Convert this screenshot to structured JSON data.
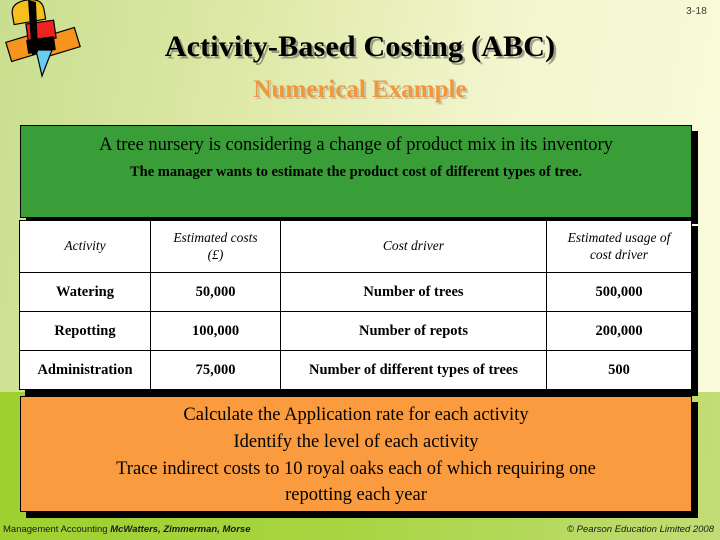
{
  "slide": {
    "number": "3-18",
    "title": "Activity-Based Costing (ABC)",
    "subtitle": "Numerical Example"
  },
  "logo": {
    "name": "abstract-geometric-logo"
  },
  "scenario": {
    "line1": "A tree nursery is considering a change of product mix in its inventory",
    "line2": "The manager wants to estimate the product cost of different types of tree."
  },
  "table": {
    "headers": [
      "Activity",
      "Estimated costs (£)",
      "Cost driver",
      "Estimated usage of cost driver"
    ],
    "header_lines": {
      "c1_l1": "Estimated costs",
      "c1_l2": "(£)",
      "c3_l1": "Estimated usage of",
      "c3_l2": "cost driver"
    },
    "rows": [
      {
        "activity": "Watering",
        "estimated_costs": "50,000",
        "cost_driver": "Number of trees",
        "estimated_usage": "500,000"
      },
      {
        "activity": "Repotting",
        "estimated_costs": "100,000",
        "cost_driver": "Number of repots",
        "estimated_usage": "200,000"
      },
      {
        "activity": "Administration",
        "estimated_costs": "75,000",
        "cost_driver": "Number of different types of trees",
        "estimated_usage": "500"
      }
    ]
  },
  "tasks": {
    "line1": "Calculate the Application rate for each activity",
    "line2": "Identify the level of each activity",
    "line3": "Trace indirect costs to 10 royal oaks each of which requiring one",
    "line4": "repotting each year"
  },
  "footer": {
    "book": "Management Accounting",
    "authors": "McWatters, Zimmerman, Morse",
    "copyright": "© Pearson Education Limited 2008"
  },
  "colors": {
    "green_box": "#3a9e38",
    "orange_box": "#f99b3e",
    "subtitle_orange": "#f2963c",
    "band_green": "#9ed12f"
  }
}
